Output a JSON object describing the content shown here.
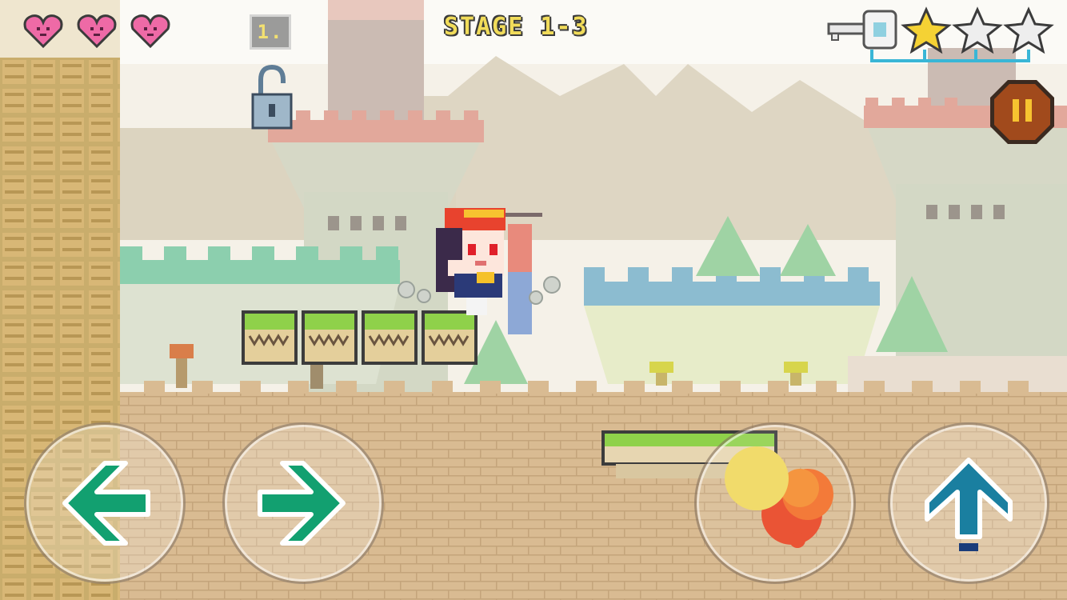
{
  "hud": {
    "stage_label": "STAGE 1-3",
    "coin_count": "1.",
    "hearts": [
      "heart-full",
      "heart-full",
      "heart-full"
    ],
    "stars": [
      "star-gold",
      "star-empty",
      "star-empty"
    ],
    "key_status": "key-collected-icon",
    "lock_status": "lock-open-icon"
  },
  "controls": {
    "left": "move-left",
    "right": "move-right",
    "attack": "fire-attack",
    "jump": "jump"
  },
  "colors": {
    "heart": "#ee6aa6",
    "star_gold": "#f5d234",
    "arrow_green": "#12a070",
    "arrow_blue": "#1a7fa0",
    "pause_bg": "#a14a1c",
    "grass": "#8fd14a"
  }
}
